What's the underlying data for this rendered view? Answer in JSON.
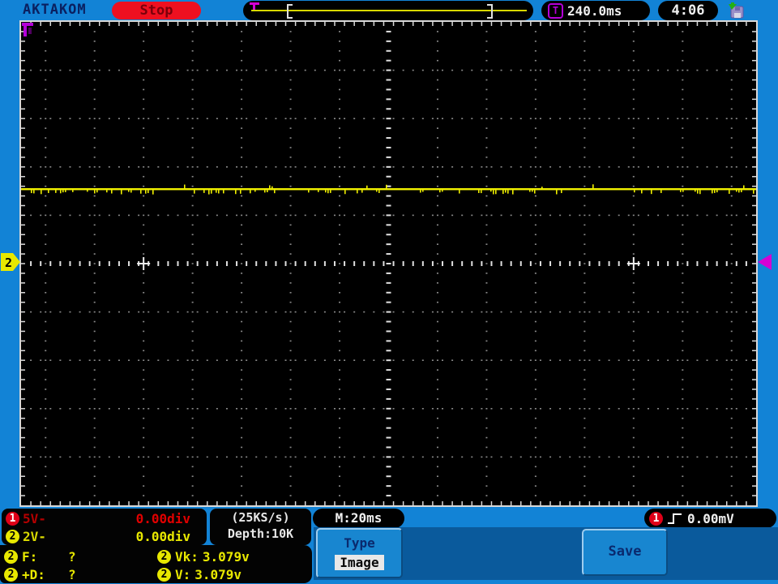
{
  "brand": "AKTAKOM",
  "top_bar": {
    "run_state": "Stop",
    "trigger_icon": "T",
    "trigger_position": "240.0ms",
    "clock": "4:06"
  },
  "channel_status": {
    "rows": [
      {
        "badge": "1",
        "scale": "5V-",
        "offset": "0.00div"
      },
      {
        "badge": "2",
        "scale": "2V-",
        "offset": "0.00div"
      }
    ]
  },
  "acquisition": {
    "sample_rate": "(25KS/s)",
    "memory_depth": "Depth:10K",
    "timebase": "M:20ms"
  },
  "trigger_status": {
    "badge": "1",
    "level": "0.00mV"
  },
  "measurements": [
    {
      "badge": "2",
      "label": "F:",
      "value": "?"
    },
    {
      "badge": "2",
      "label": "Vk:",
      "value": "3.079v"
    },
    {
      "badge": "2",
      "label": "+D:",
      "value": "?"
    },
    {
      "badge": "2",
      "label": "V:",
      "value": "3.079v"
    }
  ],
  "menu": {
    "type_label": "Type",
    "type_value": "Image",
    "save_label": "Save"
  },
  "display": {
    "ch2_marker": "2",
    "trace_channel": "2",
    "trace_level_div": 1.54
  },
  "colors": {
    "bezel": "#1283d6",
    "menu_strip": "#0a5a9c",
    "trace": "#f0f000",
    "ch1": "#e00018",
    "ch2": "#e8e800",
    "trigger_purple": "#b400d8",
    "trigger_magenta": "#d400d4",
    "stop_red": "#ee1020"
  },
  "chart_data": {
    "type": "line",
    "title": "CH2 trace (flat DC level with small noise)",
    "x_units": "ms",
    "x_range": [
      0,
      300
    ],
    "time_per_div_ms": 20,
    "y_units": "V",
    "volts_per_div": 2,
    "value_v": 3.079,
    "divisions_above_center": 1.54
  }
}
